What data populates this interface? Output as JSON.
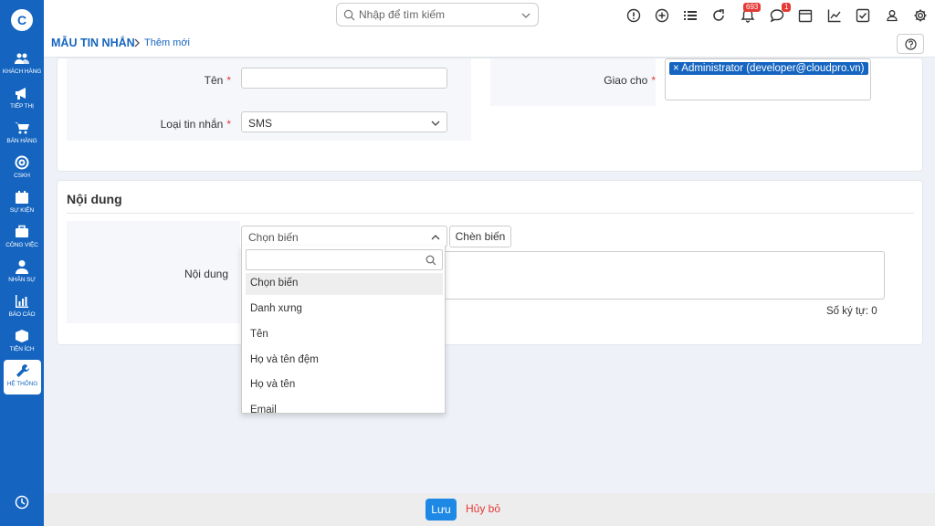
{
  "sidebar": {
    "logo": "C",
    "items": [
      {
        "label": "KHÁCH HÀNG",
        "icon": "users-icon"
      },
      {
        "label": "TIẾP THỊ",
        "icon": "megaphone-icon"
      },
      {
        "label": "BÁN HÀNG",
        "icon": "cart-icon"
      },
      {
        "label": "CSKH",
        "icon": "lifebuoy-icon"
      },
      {
        "label": "SỰ KIỆN",
        "icon": "calendar-icon"
      },
      {
        "label": "CÔNG VIỆC",
        "icon": "briefcase-icon"
      },
      {
        "label": "NHÂN SỰ",
        "icon": "person-icon"
      },
      {
        "label": "BÁO CÁO",
        "icon": "report-icon"
      },
      {
        "label": "TIỆN ÍCH",
        "icon": "box-icon"
      },
      {
        "label": "HỆ THỐNG",
        "icon": "wrench-icon"
      }
    ],
    "active_index": 9
  },
  "search": {
    "placeholder": "Nhập để tìm kiếm"
  },
  "topbar": {
    "notification_count": "693",
    "chat_count": "1"
  },
  "breadcrumb": {
    "title": "MẪU TIN NHẮN",
    "current": "Thêm mới"
  },
  "form": {
    "name_label": "Tên",
    "name_value": "",
    "type_label": "Loại tin nhắn",
    "type_value": "SMS",
    "assign_label": "Giao cho",
    "assign_tag": "Administrator (developer@cloudpro.vn)",
    "required_mark": "*"
  },
  "content": {
    "section_title": "Nội dung",
    "label": "Nội dung",
    "variable_select": "Chọn biến",
    "insert_button": "Chèn biến",
    "char_count": "Số ký tự: 0"
  },
  "dropdown": {
    "options": [
      "Chọn biến",
      "Danh xưng",
      "Tên",
      "Họ và tên đệm",
      "Họ và tên",
      "Email"
    ],
    "selected_index": 0
  },
  "footer": {
    "save_label": "Lưu",
    "cancel_label": "Hủy bỏ"
  },
  "colors": {
    "primary": "#1565c0",
    "accent": "#1e88e5",
    "danger": "#e53935"
  }
}
